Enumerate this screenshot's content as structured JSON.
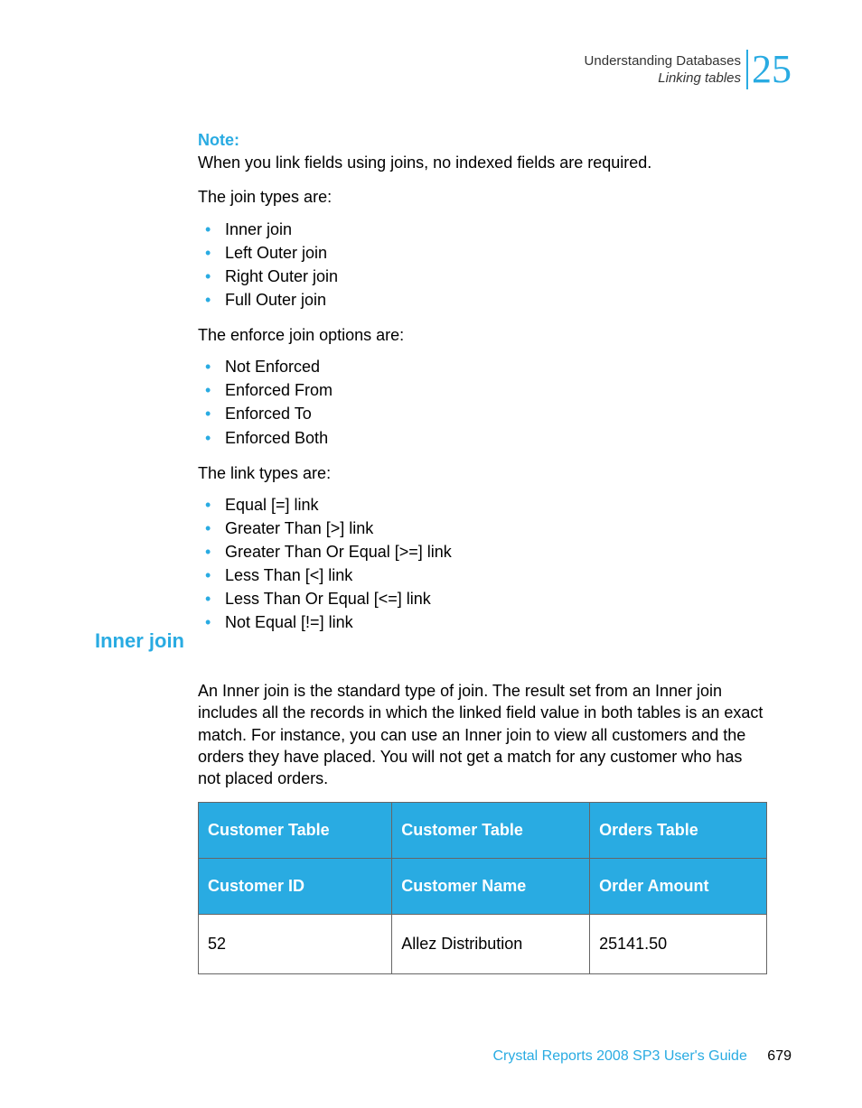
{
  "header": {
    "title": "Understanding Databases",
    "subtitle": "Linking tables",
    "chapter": "25"
  },
  "note": {
    "label": "Note:",
    "text": "When you link fields using joins, no indexed fields are required."
  },
  "joinTypesIntro": "The join types are:",
  "joinTypes": [
    "Inner join",
    "Left Outer join",
    "Right Outer join",
    "Full Outer join"
  ],
  "enforceIntro": "The enforce join options are:",
  "enforceOptions": [
    "Not Enforced",
    "Enforced From",
    "Enforced To",
    "Enforced Both"
  ],
  "linkTypesIntro": "The link types are:",
  "linkTypes": [
    "Equal [=] link",
    "Greater Than [>] link",
    "Greater Than Or Equal [>=] link",
    "Less Than [<] link",
    "Less Than Or Equal [<=] link",
    "Not Equal [!=] link"
  ],
  "section": {
    "heading": "Inner join",
    "para": "An Inner join is the standard type of join. The result set from an Inner join includes all the records in which the linked field value in both tables is an exact match. For instance, you can use an Inner join to view all customers and the orders they have placed. You will not get a match for any customer who has not placed orders."
  },
  "table": {
    "row1": [
      "Customer Table",
      "Customer Table",
      "Orders Table"
    ],
    "row2": [
      "Customer ID",
      "Customer Name",
      "Order Amount"
    ],
    "dataRows": [
      [
        "52",
        "Allez Distribution",
        "25141.50"
      ]
    ]
  },
  "footer": {
    "title": "Crystal Reports 2008 SP3 User's Guide",
    "page": "679"
  }
}
